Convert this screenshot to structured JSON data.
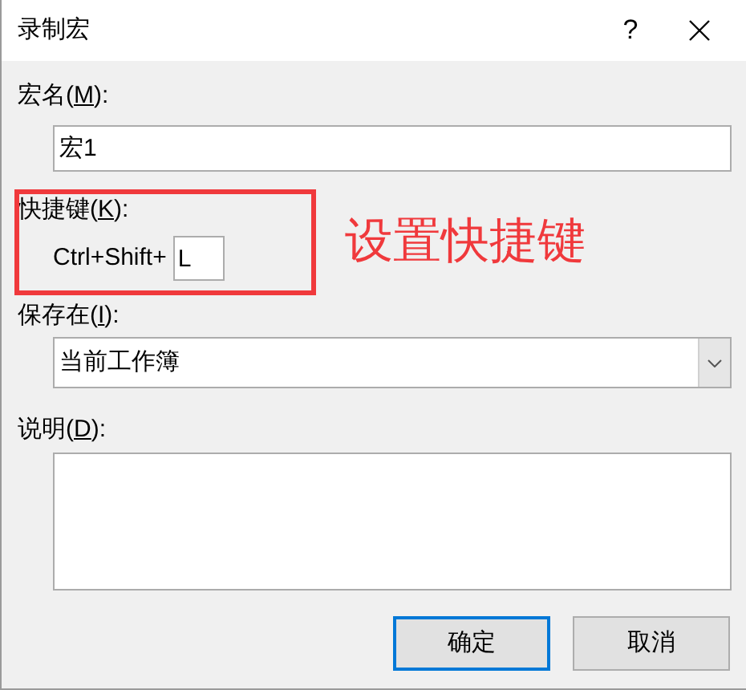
{
  "window": {
    "title": "录制宏",
    "help": "?"
  },
  "macro_name": {
    "label": [
      "宏名(",
      "M",
      "):"
    ],
    "value": "宏1"
  },
  "shortcut": {
    "label": [
      "快捷键(",
      "K",
      "):"
    ],
    "prefix": "Ctrl+Shift+",
    "value": "L"
  },
  "annotation": {
    "text": "设置快捷键",
    "color": "#f0393c"
  },
  "store_in": {
    "label": [
      "保存在(",
      "I",
      "):"
    ],
    "value": "当前工作簿"
  },
  "description": {
    "label": [
      "说明(",
      "D",
      "):"
    ]
  },
  "buttons": [
    {
      "label": "确定",
      "default": true
    },
    {
      "label": "取消",
      "default": false
    }
  ]
}
